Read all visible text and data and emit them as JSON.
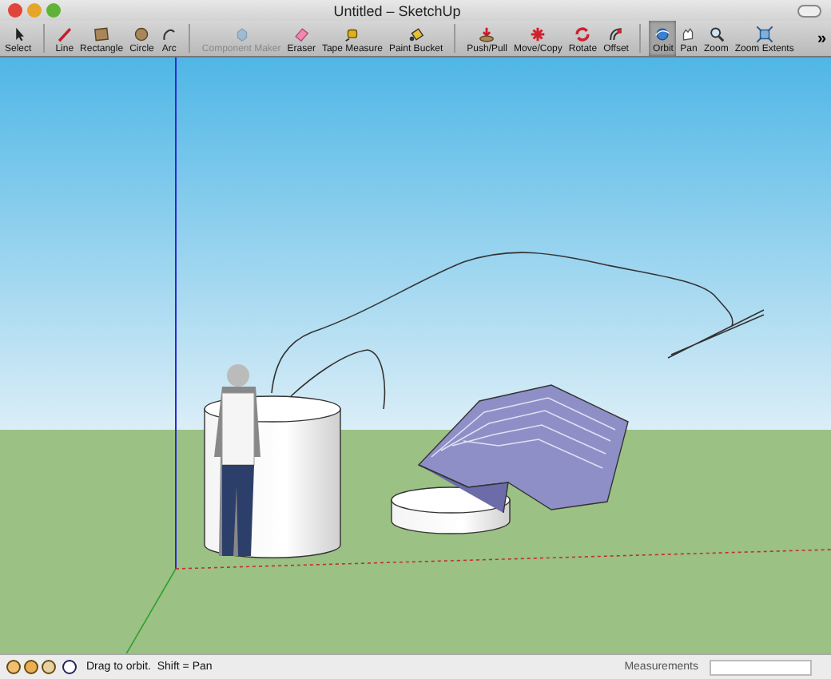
{
  "window": {
    "title": "Untitled – SketchUp"
  },
  "toolbar": {
    "groups": [
      [
        {
          "kind": "select",
          "label": "Select",
          "selected": false,
          "disabled": false
        }
      ],
      [
        {
          "kind": "line",
          "label": "Line",
          "selected": false,
          "disabled": false
        },
        {
          "kind": "rectangle",
          "label": "Rectangle",
          "selected": false,
          "disabled": false
        },
        {
          "kind": "circle",
          "label": "Circle",
          "selected": false,
          "disabled": false
        },
        {
          "kind": "arc",
          "label": "Arc",
          "selected": false,
          "disabled": false
        }
      ],
      [
        {
          "kind": "component",
          "label": "Component Maker",
          "selected": false,
          "disabled": true
        },
        {
          "kind": "eraser",
          "label": "Eraser",
          "selected": false,
          "disabled": false
        },
        {
          "kind": "tape",
          "label": "Tape Measure",
          "selected": false,
          "disabled": false
        },
        {
          "kind": "bucket",
          "label": "Paint Bucket",
          "selected": false,
          "disabled": false
        }
      ],
      [
        {
          "kind": "pushpull",
          "label": "Push/Pull",
          "selected": false,
          "disabled": false
        },
        {
          "kind": "move",
          "label": "Move/Copy",
          "selected": false,
          "disabled": false
        },
        {
          "kind": "rotate",
          "label": "Rotate",
          "selected": false,
          "disabled": false
        },
        {
          "kind": "offset",
          "label": "Offset",
          "selected": false,
          "disabled": false
        }
      ],
      [
        {
          "kind": "orbit",
          "label": "Orbit",
          "selected": true,
          "disabled": false
        },
        {
          "kind": "pan",
          "label": "Pan",
          "selected": false,
          "disabled": false
        },
        {
          "kind": "zoom",
          "label": "Zoom",
          "selected": false,
          "disabled": false
        },
        {
          "kind": "extents",
          "label": "Zoom Extents",
          "selected": false,
          "disabled": false
        }
      ]
    ],
    "overflow": "»"
  },
  "status_bar": {
    "hint": "Drag to orbit.  Shift = Pan",
    "measurements_label": "Measurements"
  }
}
